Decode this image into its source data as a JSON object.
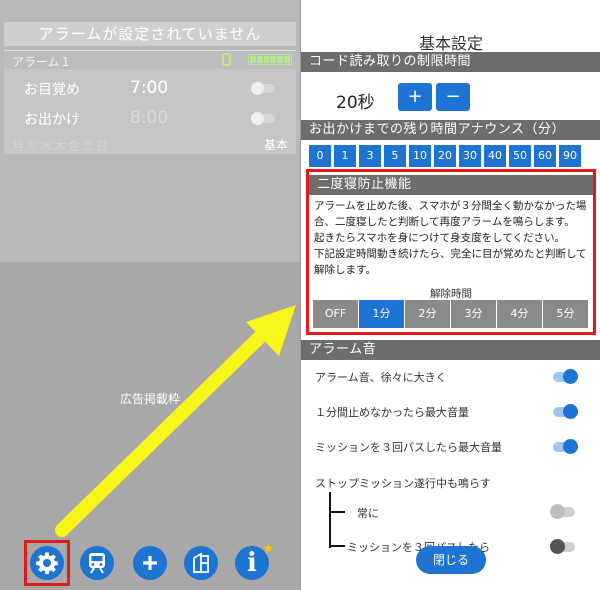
{
  "left": {
    "status": "アラームが設定されていません",
    "alarm": {
      "name": "アラーム１",
      "rows": [
        {
          "label": "お目覚め",
          "time": "7:00"
        },
        {
          "label": "お出かけ",
          "time": "8:00"
        }
      ],
      "weekdays": "月火水木金土日",
      "mode": "基本"
    },
    "ad_label": "広告掲載枠",
    "nav_icons": [
      "gear-icon",
      "train-icon",
      "plus-icon",
      "door-icon",
      "info-icon"
    ],
    "info_glyph": "i",
    "star_glyph": "★"
  },
  "right": {
    "title": "基本設定",
    "code_section": {
      "heading": "コード読み取りの制限時間",
      "value": "20秒",
      "plus": "+",
      "minus": "−"
    },
    "announce_section": {
      "heading": "お出かけまでの残り時間アナウンス（分）",
      "options": [
        "0",
        "1",
        "3",
        "5",
        "10",
        "20",
        "30",
        "40",
        "50",
        "60",
        "90"
      ]
    },
    "snooze_section": {
      "heading": "二度寝防止機能",
      "description": [
        "アラームを止めた後、スマホが３分間全く動かなかった場",
        "合、二度寝したと判断して再度アラームを鳴らします。",
        "起きたらスマホを身につけて身支度をしてください。",
        "下記設定時間動き続けたら、完全に目が覚めたと判断して",
        "解除します。"
      ],
      "release_label": "解除時間",
      "release_options": [
        "OFF",
        "1分",
        "2分",
        "3分",
        "4分",
        "5分"
      ],
      "release_selected": "1分"
    },
    "sound_section": {
      "heading": "アラーム音",
      "options": [
        "アラーム音、徐々に大きく",
        "１分間止めなかったら最大音量",
        "ミッションを３回パスしたら最大音量"
      ],
      "stop_mission_label": "ストップミッション遂行中も鳴らす",
      "sub_options": [
        "常に",
        "ミッションを３回パスしたら"
      ]
    },
    "close_label": "閉じる"
  },
  "colors": {
    "accent": "#1e74d2",
    "highlight": "#e01b1b",
    "arrow": "#f8f518"
  }
}
